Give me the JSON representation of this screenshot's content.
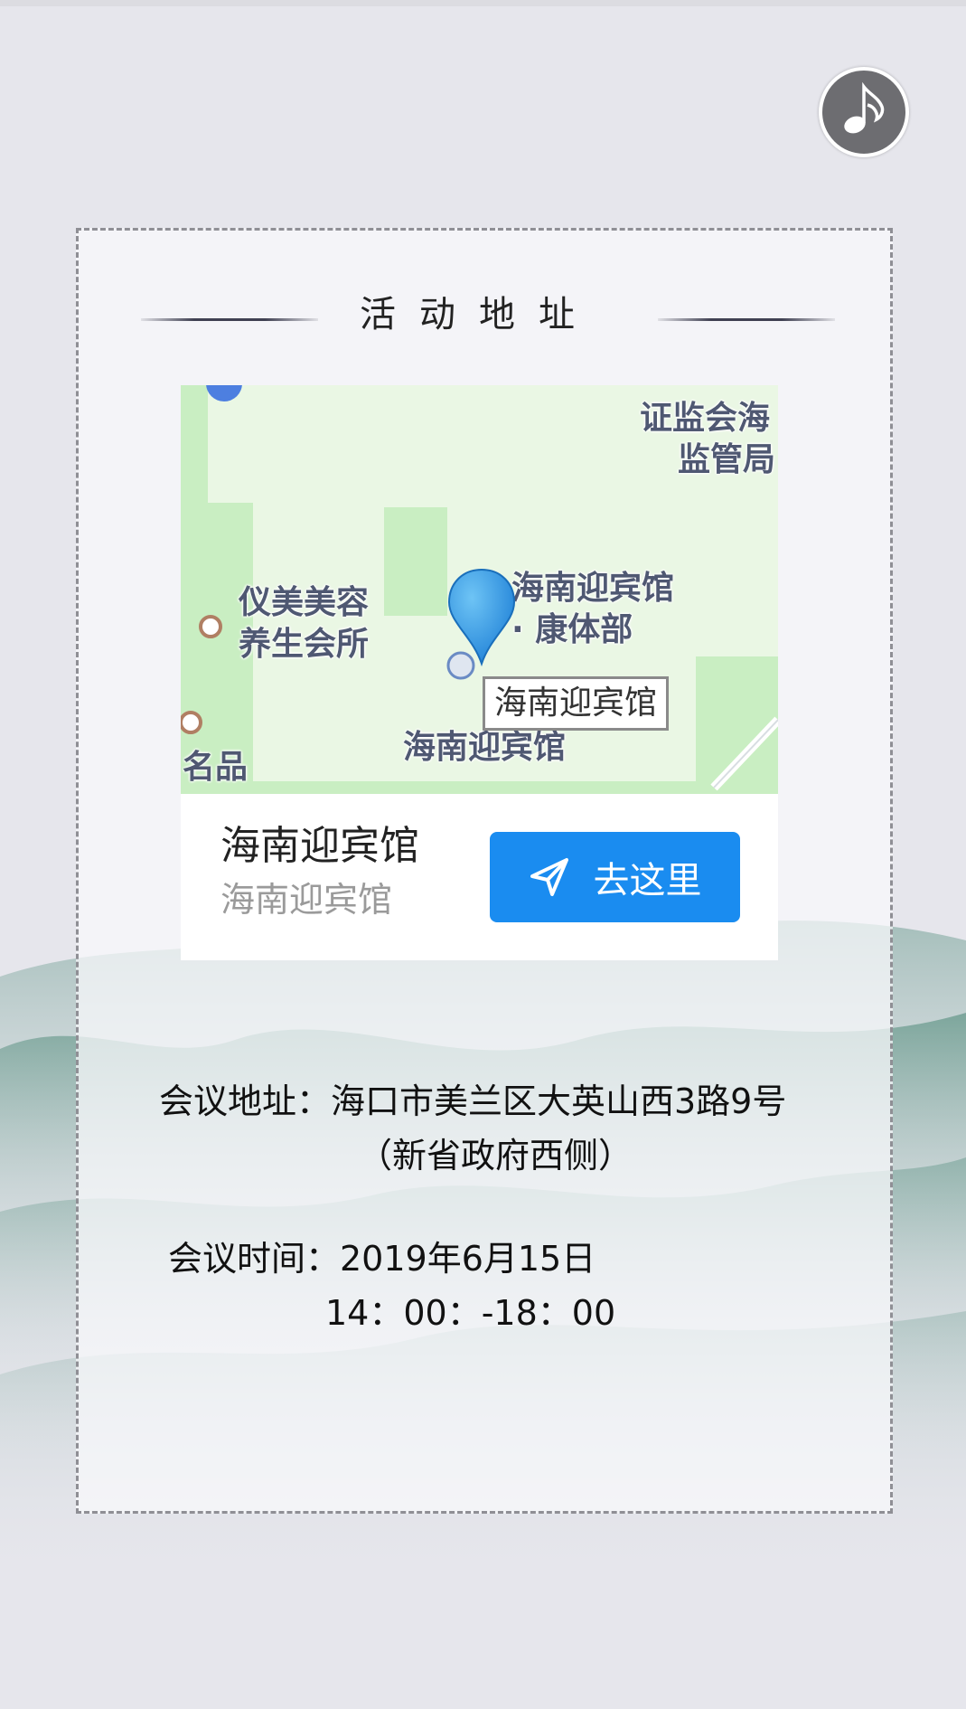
{
  "section": {
    "title": "活动地址"
  },
  "map": {
    "labels": {
      "top_right_1": "证监会海",
      "top_right_2": "监管局",
      "left_1": "仪美美容",
      "left_2": "养生会所",
      "kangti_1": "海南迎宾馆",
      "kangti_2": "· 康体部",
      "callout": "海南迎宾馆",
      "bottom": "海南迎宾馆",
      "bottom_left": "名品"
    }
  },
  "place": {
    "name": "海南迎宾馆",
    "subtitle": "海南迎宾馆",
    "go_label": "去这里"
  },
  "info": {
    "address_line1": "会议地址：海口市美兰区大英山西3路9号",
    "address_line2": "（新省政府西侧）",
    "time_line1": "会议时间：2019年6月15日",
    "time_line2": "14：00：-18：00"
  },
  "colors": {
    "accent_blue": "#1a8cf0",
    "pin_blue": "#2e9ae8",
    "map_green": "#c8ecc0"
  },
  "icons": {
    "music": "music-note-icon",
    "navigate": "paper-plane-icon",
    "pin": "map-pin-icon"
  }
}
